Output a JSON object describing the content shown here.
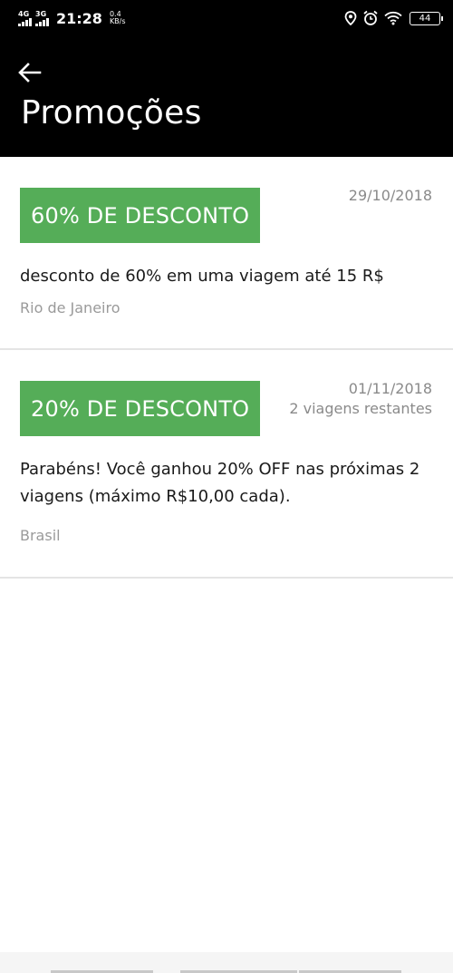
{
  "status_bar": {
    "network1": "4G",
    "network2": "3G",
    "time": "21:28",
    "speed_value": "0.4",
    "speed_unit": "KB/s",
    "battery": "44"
  },
  "header": {
    "title": "Promoções",
    "back_icon": "arrow-left-icon"
  },
  "promotions": [
    {
      "badge": "60% DE DESCONTO",
      "date": "29/10/2018",
      "remaining": "",
      "description": "desconto de 60% em uma viagem até 15 R$",
      "location": "Rio de Janeiro"
    },
    {
      "badge": "20% DE DESCONTO",
      "date": "01/11/2018",
      "remaining": "2 viagens restantes",
      "description": "Parabéns! Você ganhou 20% OFF nas próximas 2 viagens (máximo R$10,00 cada).",
      "location": "Brasil"
    }
  ],
  "colors": {
    "badge": "#55ad58",
    "header_bg": "#000000",
    "meta_text": "#8a8a8a"
  }
}
